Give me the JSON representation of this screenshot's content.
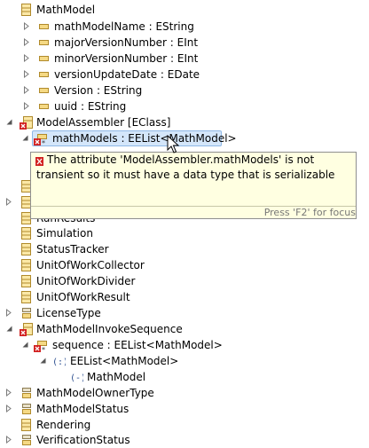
{
  "tree": [
    {
      "text": "MathModel",
      "icon": "class-icon"
    },
    {
      "text": "mathModelName : EString",
      "icon": "attribute-icon"
    },
    {
      "text": "majorVersionNumber : EInt",
      "icon": "attribute-icon"
    },
    {
      "text": "minorVersionNumber : EInt",
      "icon": "attribute-icon"
    },
    {
      "text": "versionUpdateDate : EDate",
      "icon": "attribute-icon"
    },
    {
      "text": "Version : EString",
      "icon": "attribute-icon"
    },
    {
      "text": "uuid : EString",
      "icon": "attribute-icon"
    },
    {
      "text": "ModelAssembler [EClass]",
      "icon": "class-error-icon"
    },
    {
      "text": "mathModels : EEList<MathModel>",
      "icon": "attribute-error-icon"
    },
    {
      "text": "Simulation",
      "icon": "class-icon"
    },
    {
      "text": "StatusTracker",
      "icon": "class-icon"
    },
    {
      "text": "UnitOfWorkCollector",
      "icon": "class-icon"
    },
    {
      "text": "UnitOfWorkDivider",
      "icon": "class-icon"
    },
    {
      "text": "UnitOfWorkResult",
      "icon": "class-icon"
    },
    {
      "text": "LicenseType",
      "icon": "enum-icon"
    },
    {
      "text": "MathModelInvokeSequence",
      "icon": "class-error-icon"
    },
    {
      "text": "sequence : EEList<MathModel>",
      "icon": "attribute-error-icon"
    },
    {
      "text": "EEList<MathModel>",
      "icon": "generic-type-icon"
    },
    {
      "text": "MathModel",
      "icon": "type-argument-icon"
    },
    {
      "text": "MathModelOwnerType",
      "icon": "enum-icon"
    },
    {
      "text": "MathModelStatus",
      "icon": "enum-icon"
    },
    {
      "text": "Rendering",
      "icon": "class-icon"
    },
    {
      "text": "VerificationStatus",
      "icon": "enum-icon"
    }
  ],
  "partial_behind_tooltip": "RunResults",
  "tooltip": {
    "message": "The attribute 'ModelAssembler.mathModels' is not transient so it must have a data type that is serializable",
    "footer": "Press 'F2' for focus"
  },
  "colors": {
    "selection": "#d4e6fa",
    "tooltip_bg": "#ffffe1",
    "error": "#d22222",
    "class_icon": "#c9a640"
  }
}
